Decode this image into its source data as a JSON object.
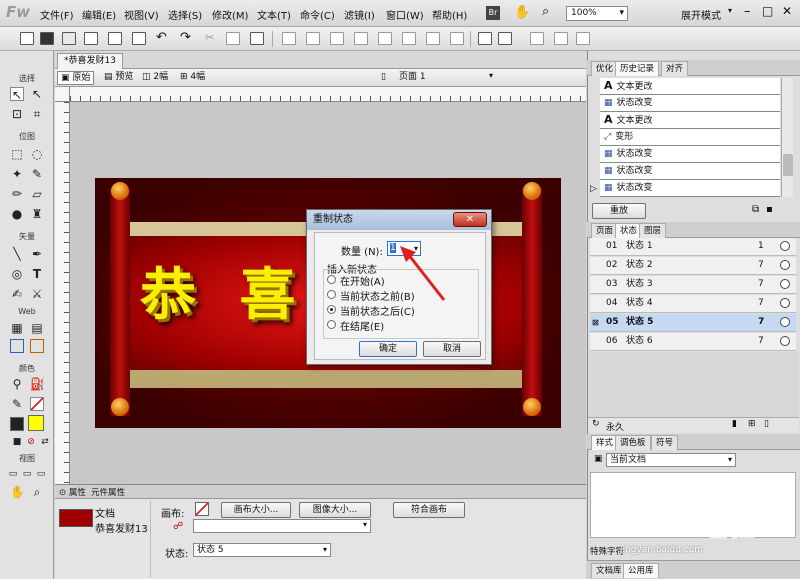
{
  "app": {
    "logo": "Fw",
    "workspace": "展开模式",
    "zoom": "100%"
  },
  "menu": [
    "文件(F)",
    "编辑(E)",
    "视图(V)",
    "选择(S)",
    "修改(M)",
    "文本(T)",
    "命令(C)",
    "滤镜(I)",
    "窗口(W)",
    "帮助(H)"
  ],
  "tools": {
    "select": "选择",
    "bitmap": "位图",
    "vector": "矢量",
    "web": "Web",
    "colors": "颜色",
    "view": "视图"
  },
  "document": {
    "tab": "*恭喜发财13",
    "views": [
      "原始",
      "预览",
      "2幅",
      "4幅"
    ],
    "page": "页面 1",
    "banner_text": "恭 喜"
  },
  "dialog": {
    "title": "重制状态",
    "count_label": "数量 (N):",
    "count_value": "1",
    "insert_label": "插入新状态",
    "options": [
      "在开始(A)",
      "当前状态之前(B)",
      "当前状态之后(C)",
      "在结尾(E)"
    ],
    "ok": "确定",
    "cancel": "取消"
  },
  "props": {
    "tab1": "属性",
    "tab2": "元件属性",
    "doc_label": "文档",
    "doc_name": "恭喜发财13",
    "canvas_label": "画布:",
    "canvas_size": "画布大小...",
    "image_size": "图像大小...",
    "fit_canvas": "符合画布",
    "state_label": "状态:",
    "state_value": "状态 5"
  },
  "history": {
    "tabs": [
      "优化",
      "历史记录",
      "对齐"
    ],
    "rows": [
      "文本更改",
      "状态改变",
      "文本更改",
      "变形",
      "状态改变",
      "状态改变",
      "状态改变"
    ],
    "replay": "重放"
  },
  "states": {
    "tabs": [
      "页面",
      "状态",
      "图层"
    ],
    "rows": [
      {
        "num": "01",
        "name": "状态 1",
        "delay": "1"
      },
      {
        "num": "02",
        "name": "状态 2",
        "delay": "7"
      },
      {
        "num": "03",
        "name": "状态 3",
        "delay": "7"
      },
      {
        "num": "04",
        "name": "状态 4",
        "delay": "7"
      },
      {
        "num": "05",
        "name": "状态 5",
        "delay": "7"
      },
      {
        "num": "06",
        "name": "状态 6",
        "delay": "7"
      }
    ],
    "loop": "永久"
  },
  "styles": {
    "tabs": [
      "样式",
      "调色板",
      "符号"
    ],
    "scope": "当前文档"
  },
  "bottom": {
    "tab_special": "特殊字符",
    "lib": "文档库",
    "common": "公用库",
    "watermark": "Baidu 经验",
    "watermark_url": "jingyan.baidu.com"
  }
}
